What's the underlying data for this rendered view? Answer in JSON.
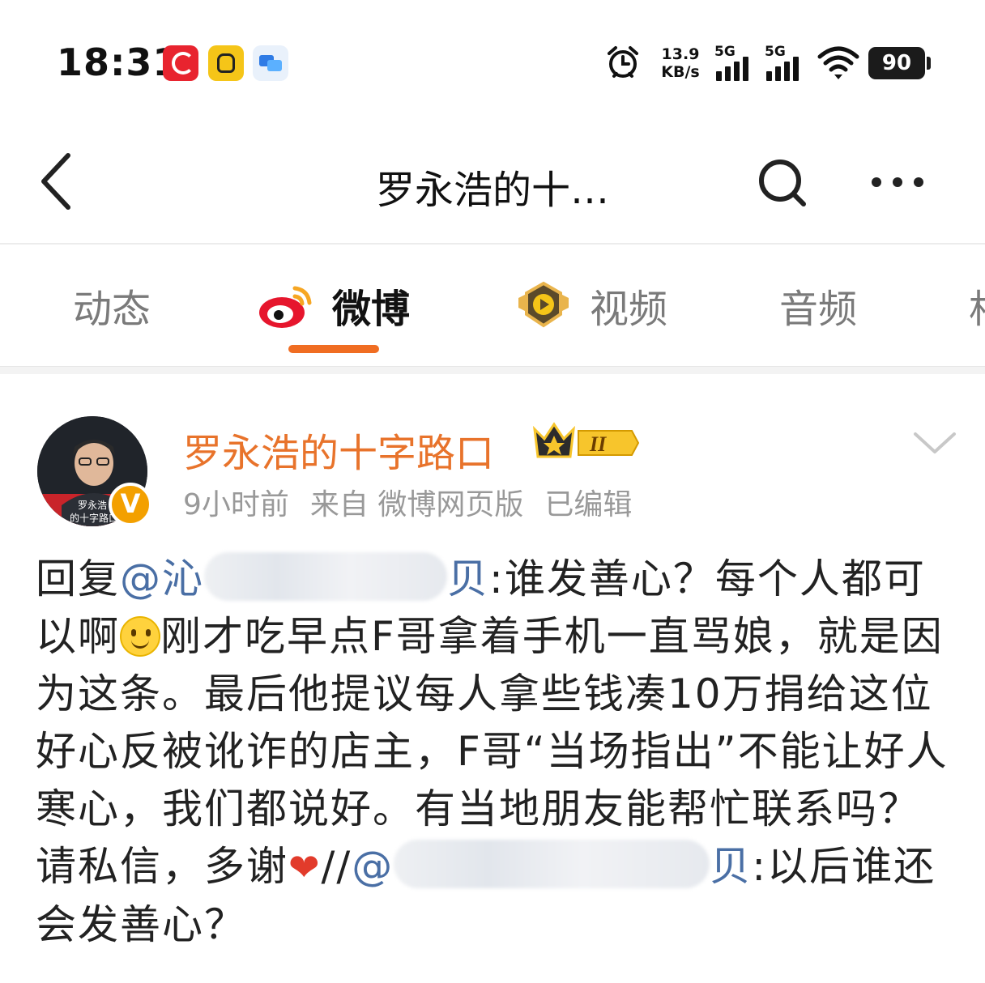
{
  "status_bar": {
    "time": "18:31",
    "net_speed_value": "13.9",
    "net_speed_unit": "KB/s",
    "signal_1_label": "5G",
    "signal_2_label": "5G",
    "battery": "90",
    "notification_icons": [
      "news-app-icon",
      "hand-app-icon",
      "chat-app-icon"
    ]
  },
  "nav": {
    "title": "罗永浩的十…"
  },
  "tabs": [
    {
      "label": "动态"
    },
    {
      "label": "微博",
      "active": true
    },
    {
      "label": "视频"
    },
    {
      "label": "音频"
    },
    {
      "label": "相"
    }
  ],
  "post": {
    "author": "罗永浩的十字路口",
    "avatar_text_1": "罗永浩",
    "avatar_text_2": "的十字路口",
    "member_level": "II",
    "verified_mark": "V",
    "time": "9小时前",
    "source": "来自 微博网页版",
    "edited": "已编辑",
    "body": {
      "reply_prefix": "回复",
      "mention_1_visible": "@沁",
      "mention_1_end": "贝",
      "part_1": ":谁发善心？每个人都可以啊",
      "part_2": "刚才吃早点F哥拿着手机一直骂娘，就是因为这条。最后他提议每人拿些钱凑10万捐给这位好心反被讹诈的店主，F哥“当场指出”不能让好人寒心，我们都说好。有当地朋友能帮忙联系吗？请私信，多谢",
      "repost_sep": "//",
      "mention_2_visible": "@",
      "mention_2_end": "贝",
      "part_3": ":以后谁还会发善心？"
    }
  },
  "colors": {
    "accent": "#f06d22",
    "author_name": "#e8732b",
    "mention": "#4a6fa5",
    "meta": "#999999"
  }
}
